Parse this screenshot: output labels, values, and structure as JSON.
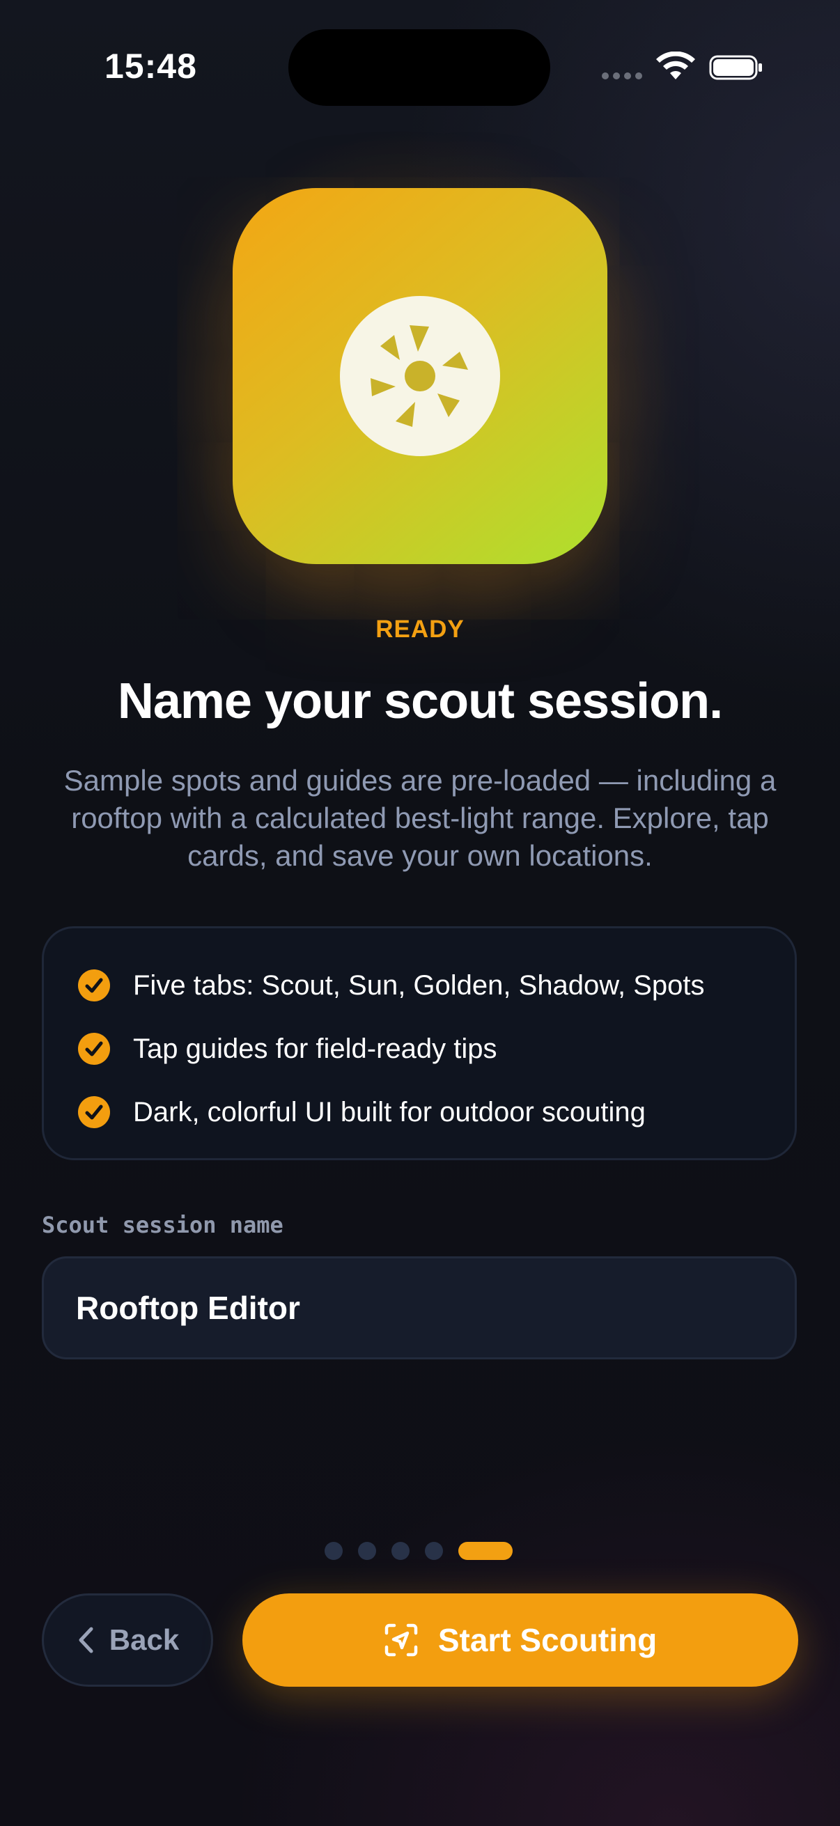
{
  "status_bar": {
    "time": "15:48"
  },
  "onboarding": {
    "app_icon": "aperture-icon",
    "eyebrow": "READY",
    "title": "Name your scout session.",
    "description": "Sample spots and guides are pre-loaded — including a rooftop with a calculated best-light range. Explore, tap cards, and save your own locations.",
    "features": [
      {
        "icon": "checkmark-circle-icon",
        "text": "Five tabs: Scout, Sun, Golden, Shadow, Spots"
      },
      {
        "icon": "checkmark-circle-icon",
        "text": "Tap guides for field-ready tips"
      },
      {
        "icon": "checkmark-circle-icon",
        "text": "Dark, colorful UI built for outdoor scouting"
      }
    ],
    "session_field": {
      "label": "Scout session name",
      "value": "Rooftop Editor"
    },
    "pager": {
      "total": 5,
      "current": 5
    },
    "back_button": {
      "icon": "chevron-left-icon",
      "label": "Back"
    },
    "start_button": {
      "icon": "scan-location-icon",
      "label": "Start Scouting"
    }
  },
  "colors": {
    "accent": "#f39e0f",
    "background": "#0e1016",
    "card": "#0f141f",
    "muted_text": "#8f9ab3"
  }
}
